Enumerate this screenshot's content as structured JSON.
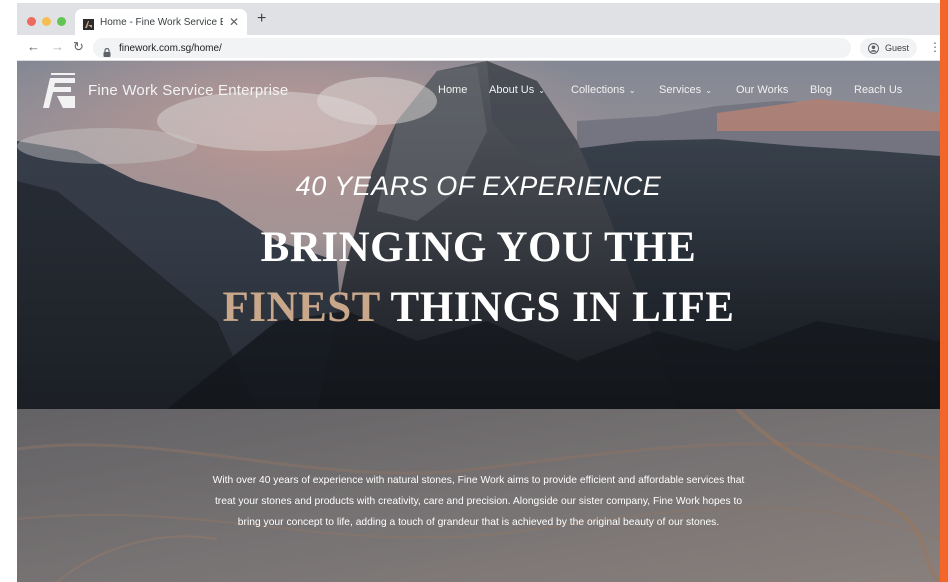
{
  "browser": {
    "tab_title": "Home - Fine Work Service Ent",
    "url": "finework.com.sg/home/",
    "profile_label": "Guest"
  },
  "site": {
    "brand_name": "Fine Work Service Enterprise",
    "nav": [
      {
        "label": "Home",
        "dropdown": false
      },
      {
        "label": "About Us",
        "dropdown": true
      },
      {
        "label": "Collections",
        "dropdown": true
      },
      {
        "label": "Services",
        "dropdown": true
      },
      {
        "label": "Our Works",
        "dropdown": false
      },
      {
        "label": "Blog",
        "dropdown": false
      },
      {
        "label": "Reach Us",
        "dropdown": false
      }
    ],
    "hero": {
      "tagline": "40 YEARS OF EXPERIENCE",
      "headline_line1": "BRINGING YOU THE",
      "headline_highlight": "FINEST",
      "headline_line2_rest": " THINGS IN LIFE"
    },
    "about": {
      "line1": "With over 40 years of experience with natural stones, Fine Work aims to provide efficient and affordable services that",
      "line2": "treat your stones and products with creativity, care and precision. Alongside our sister company, Fine Work hopes to",
      "line3": "bring your concept to life, adding a touch of grandeur that is achieved by the original beauty of our stones."
    }
  },
  "colors": {
    "accent_orange": "#f4652a",
    "highlight_gold": "#c9a78b"
  }
}
